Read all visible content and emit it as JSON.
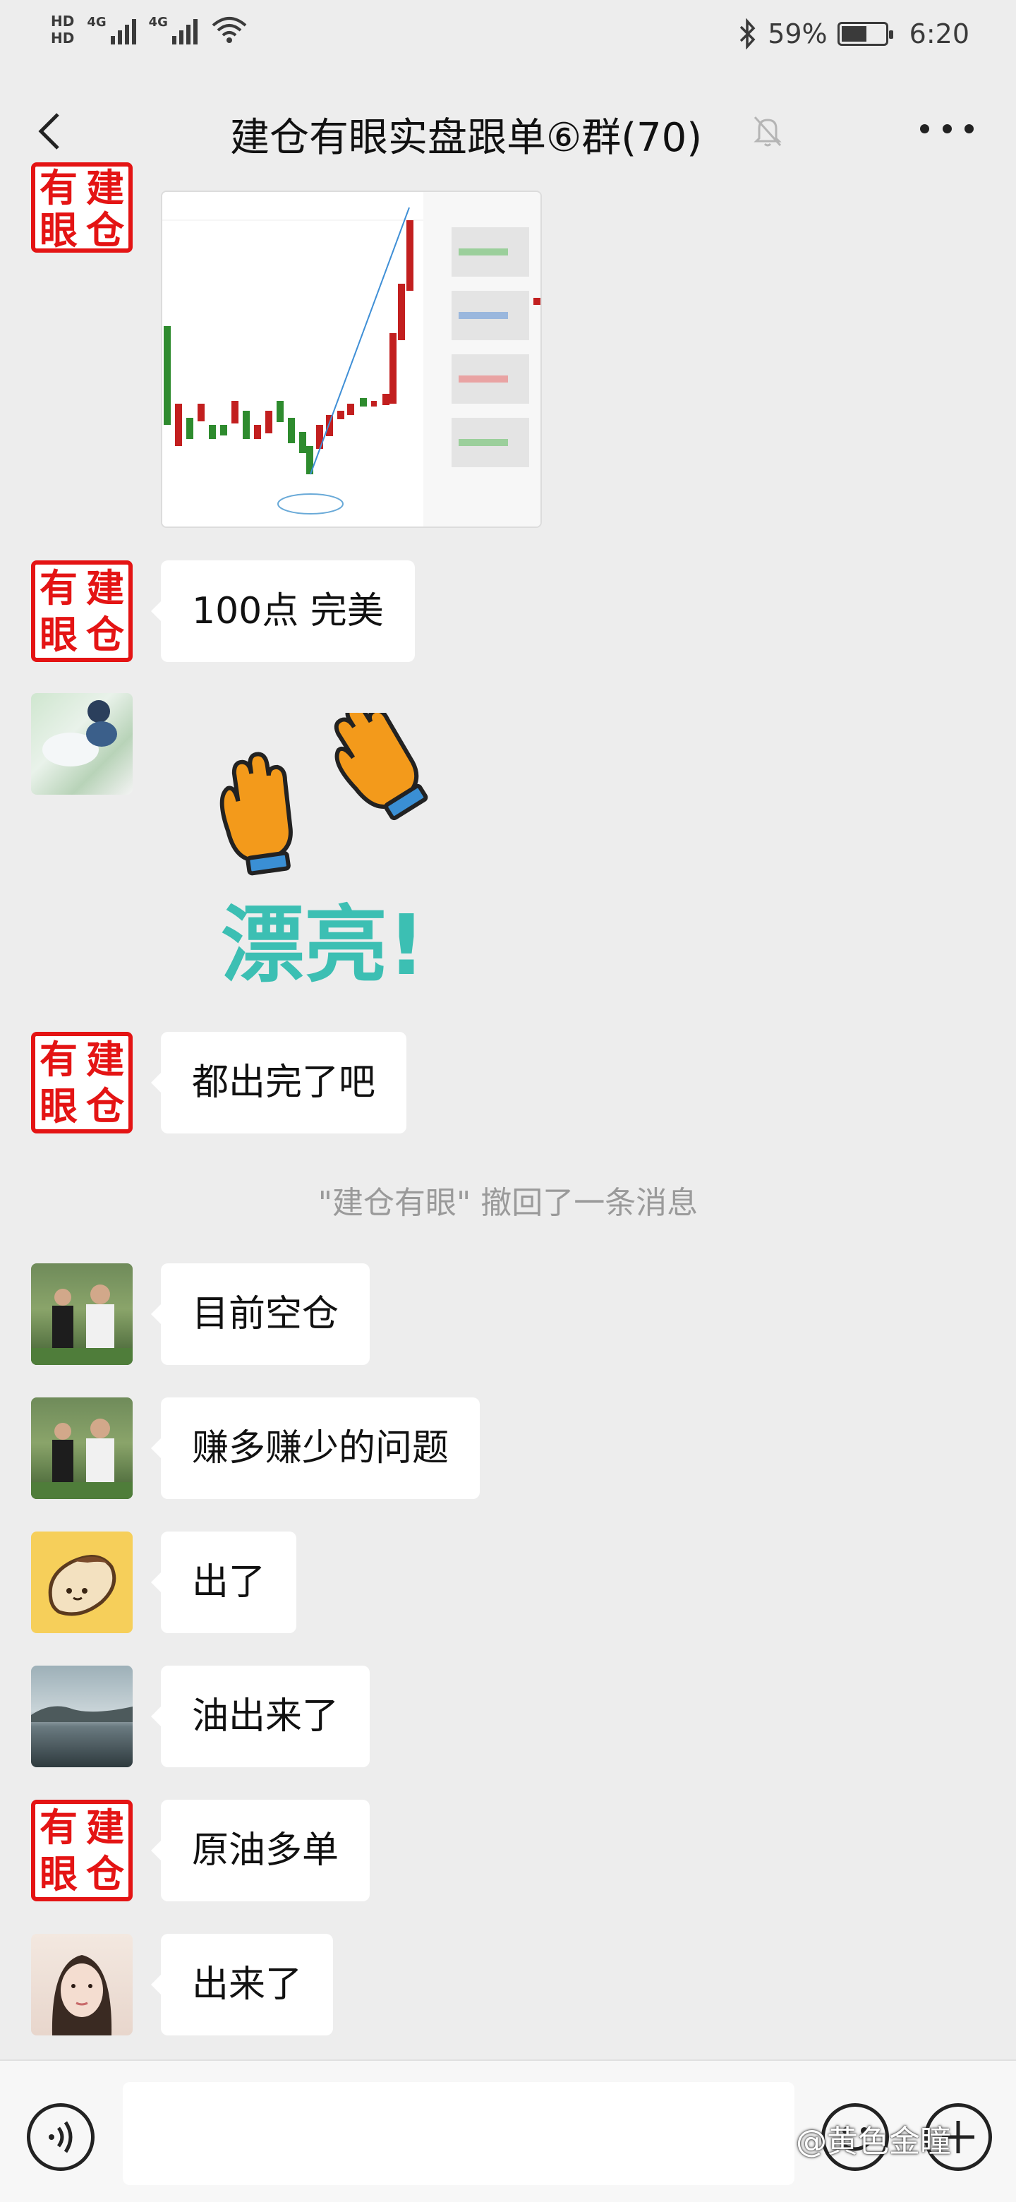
{
  "status_bar": {
    "hd1": "HD",
    "hd2": "HD",
    "net1": "4G",
    "net2": "4G",
    "battery_pct": "59%",
    "battery_level": 0.59,
    "time": "6:20"
  },
  "header": {
    "title": "建仓有眼实盘跟单⑥群(70)"
  },
  "logo_avatar": {
    "c1": "有",
    "c2": "建",
    "c3": "眼",
    "c4": "仓"
  },
  "messages": [
    {
      "text": "100点  完美"
    },
    {
      "text": "都出完了吧"
    },
    {
      "text": "目前空仓"
    },
    {
      "text": "赚多赚少的问题"
    },
    {
      "text": "出了"
    },
    {
      "text": "油出来了"
    },
    {
      "text": "原油多单"
    },
    {
      "text": "出来了"
    }
  ],
  "system_notice": "\"建仓有眼\" 撤回了一条消息",
  "sticker": {
    "text": "漂亮!"
  },
  "watermark": "@黄色金瞳",
  "colors": {
    "background": "#ededed",
    "bubble": "#ffffff",
    "logo_red": "#e41414",
    "sticker_teal": "#3cbfb3",
    "sticker_orange": "#f39a1b"
  }
}
